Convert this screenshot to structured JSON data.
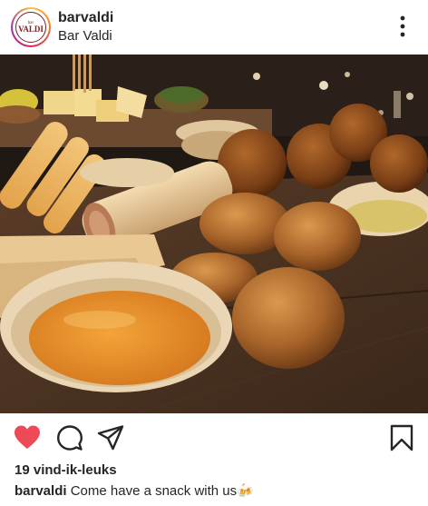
{
  "post": {
    "username": "barvaldi",
    "location": "Bar Valdi",
    "avatar_logo_top": "bar",
    "avatar_logo_main": "VALDI",
    "likes_text": "19 vind-ik-leuks",
    "caption_username": "barvaldi",
    "caption_text": "Come have a snack with us",
    "caption_emoji": "🍻"
  },
  "icons": {
    "more": "more-options-icon",
    "like": "heart-icon",
    "comment": "comment-icon",
    "share": "share-icon",
    "save": "bookmark-icon"
  },
  "colors": {
    "like_red": "#ed4956",
    "text": "#262626",
    "hashtag": "#1c4c8c"
  }
}
